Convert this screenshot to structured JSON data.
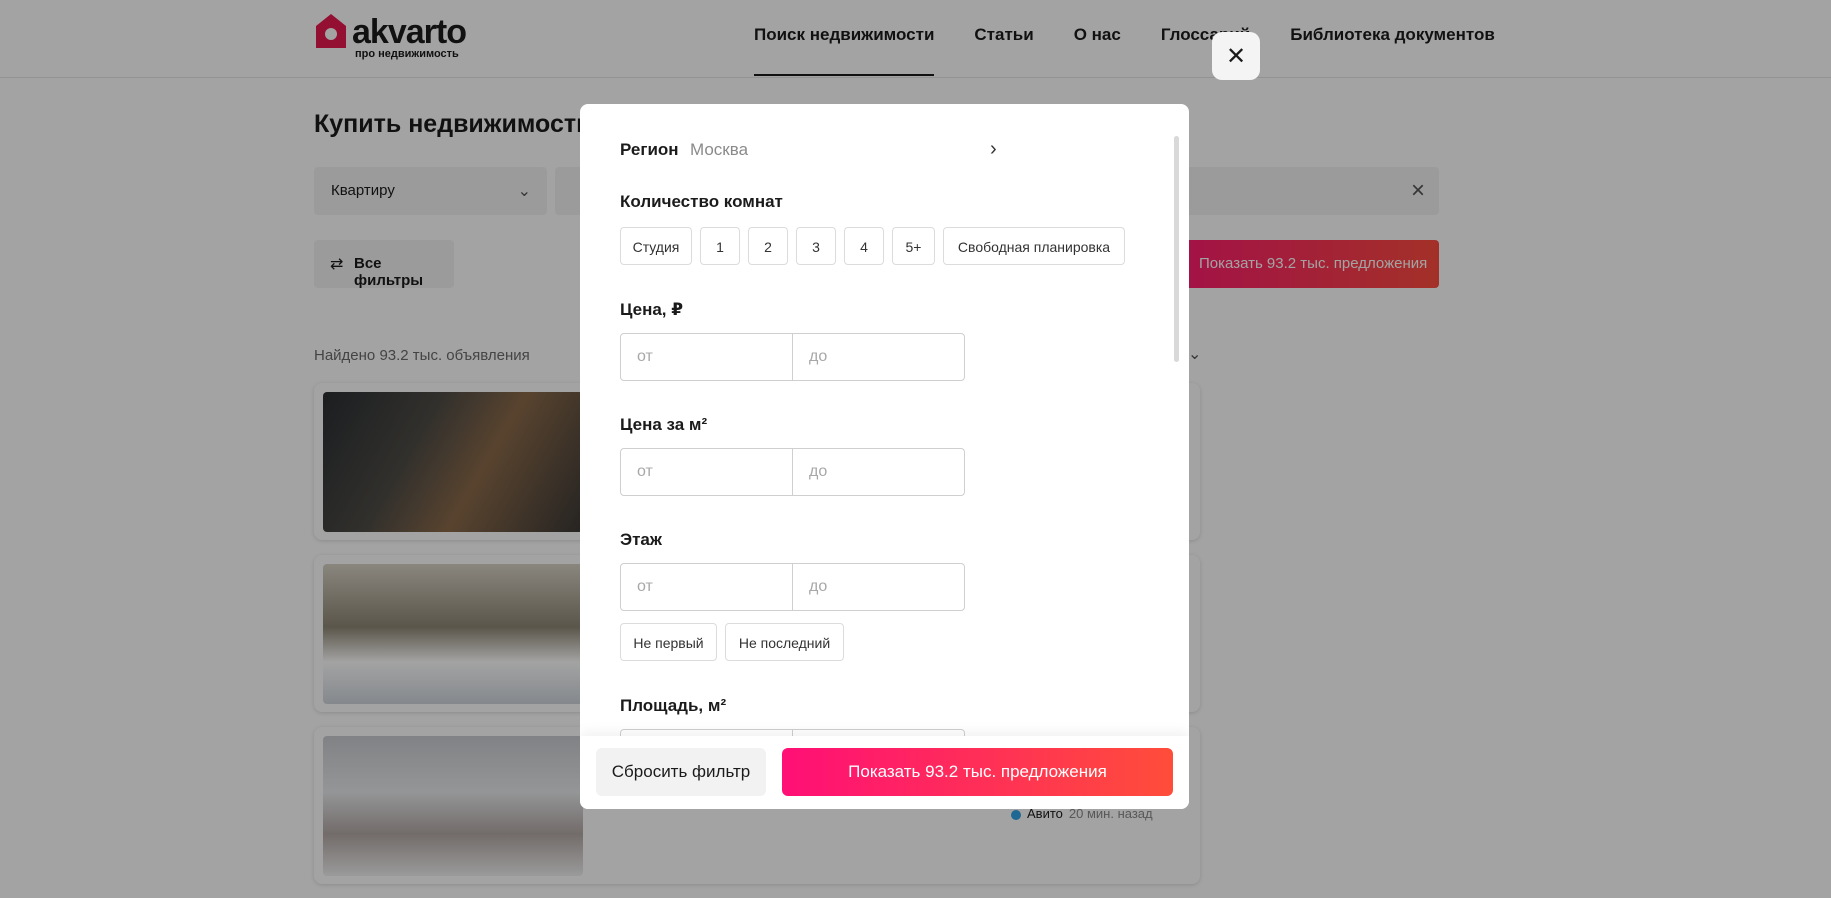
{
  "header": {
    "logo_text": "akvarto",
    "logo_sub": "про недвижимость",
    "nav": [
      "Поиск недвижимости",
      "Статьи",
      "О нас",
      "Глоссарий",
      "Библиотека документов"
    ]
  },
  "search": {
    "page_title": "Купить недвижимость",
    "type_select": "Квартиру",
    "all_filters": "Все фильтры",
    "show_button": "Показать 93.2 тыс. предложения",
    "found_text": "Найдено 93.2 тыс. объявления"
  },
  "listing": {
    "source": "Авито",
    "time": "20 мин. назад"
  },
  "modal": {
    "region_label": "Регион",
    "region_value": "Москва",
    "rooms_label": "Количество комнат",
    "rooms": [
      "Студия",
      "1",
      "2",
      "3",
      "4",
      "5+",
      "Свободная планировка"
    ],
    "price_label": "Цена, ₽",
    "price_sqm_label": "Цена за м²",
    "floor_label": "Этаж",
    "floor_options": [
      "Не первый",
      "Не последний"
    ],
    "area_label": "Площадь, м²",
    "from_placeholder": "от",
    "to_placeholder": "до",
    "reset_button": "Сбросить фильтр",
    "apply_button": "Показать 93.2 тыс. предложения"
  },
  "colors": {
    "accent_start": "#ff0f76",
    "accent_end": "#ff4d3a",
    "logo": "#e8194f"
  },
  "icons": [
    "logo-house-icon",
    "chevron-down-icon",
    "clear-icon",
    "filter-sliders-icon",
    "chevron-right-icon",
    "close-icon",
    "avito-icon"
  ]
}
